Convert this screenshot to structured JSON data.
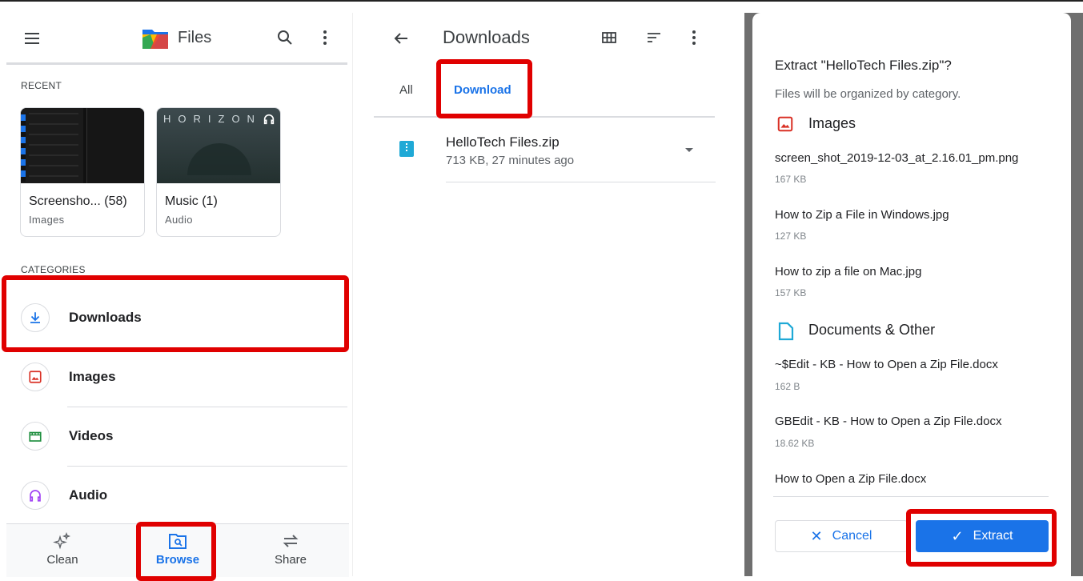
{
  "app": {
    "title": "Files",
    "recent_label": "RECENT",
    "categories_label": "CATEGORIES",
    "recent": [
      {
        "title": "Screensho... (58)",
        "subtitle": "Images"
      },
      {
        "title": "Music (1)",
        "subtitle": "Audio",
        "thumb_text": "HORIZON"
      }
    ],
    "categories": [
      {
        "label": "Downloads",
        "icon": "download-icon",
        "color": "#1a73e8"
      },
      {
        "label": "Images",
        "icon": "image-icon",
        "color": "#d93025"
      },
      {
        "label": "Videos",
        "icon": "video-icon",
        "color": "#1e8e3e"
      },
      {
        "label": "Audio",
        "icon": "headphones-icon",
        "color": "#a142f4"
      }
    ],
    "bottom_nav": [
      {
        "label": "Clean",
        "icon": "sparkle-icon"
      },
      {
        "label": "Browse",
        "icon": "browse-icon"
      },
      {
        "label": "Share",
        "icon": "swap-icon"
      }
    ]
  },
  "downloads": {
    "title": "Downloads",
    "tabs": [
      "All",
      "Download"
    ],
    "file": {
      "name": "HelloTech Files.zip",
      "meta": "713 KB, 27 minutes ago"
    }
  },
  "dialog": {
    "title": "Extract \"HelloTech Files.zip\"?",
    "subtitle": "Files will be organized by category.",
    "images_heading": "Images",
    "images": [
      {
        "name": "screen_shot_2019-12-03_at_2.16.01_pm.png",
        "size": "167 KB"
      },
      {
        "name": "How to Zip a File in Windows.jpg",
        "size": "127 KB"
      },
      {
        "name": "How to zip a file on Mac.jpg",
        "size": "157 KB"
      }
    ],
    "docs_heading": "Documents & Other",
    "docs": [
      {
        "name": "~$Edit - KB - How to Open a Zip File.docx",
        "size": "162 B"
      },
      {
        "name": "GBEdit - KB - How to Open a Zip File.docx",
        "size": "18.62 KB"
      },
      {
        "name": "How to Open a Zip File.docx",
        "size": ""
      }
    ],
    "cancel_label": "Cancel",
    "extract_label": "Extract"
  },
  "colors": {
    "accent": "#1a73e8",
    "highlight": "#e00000"
  }
}
